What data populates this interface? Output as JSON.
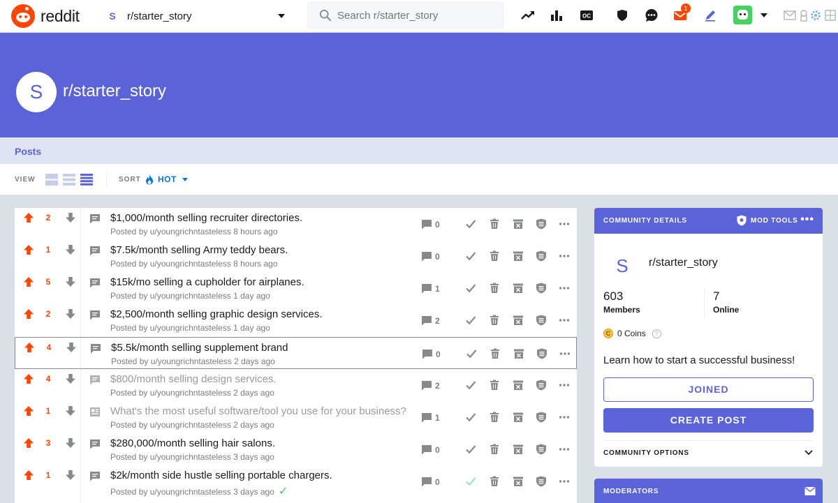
{
  "header": {
    "brand": "reddit",
    "community_icon_letter": "S",
    "community_name": "r/starter_story",
    "search_placeholder": "Search r/starter_story",
    "notification_count": "1",
    "icons": [
      "popular-icon",
      "all-icon",
      "oc-icon",
      "shield-icon",
      "chat-icon",
      "inbox-icon",
      "create-post-icon",
      "avatar",
      "chevron-down-icon",
      "mail-icon",
      "ext-icon",
      "settings-icon"
    ],
    "brand_color": "#ff4500"
  },
  "banner": {
    "icon_letter": "S",
    "title": "r/starter_story",
    "color": "#5b63d9"
  },
  "tabs": {
    "posts": "Posts"
  },
  "sortbar": {
    "view_label": "VIEW",
    "sort_label": "SORT",
    "sort_value": "HOT"
  },
  "posts": [
    {
      "score": "2",
      "title": "$1,000/month selling recruiter directories.",
      "author": "Posted by u/youngrichntasteless",
      "time": "8 hours ago",
      "comments": "0",
      "read": false,
      "approved": false,
      "type": "text"
    },
    {
      "score": "1",
      "title": "$7.5k/month selling Army teddy bears.",
      "author": "Posted by u/youngrichntasteless",
      "time": "8 hours ago",
      "comments": "0",
      "read": false,
      "approved": false,
      "type": "text"
    },
    {
      "score": "5",
      "title": "$15k/mo selling a cupholder for airplanes.",
      "author": "Posted by u/youngrichntasteless",
      "time": "1 day ago",
      "comments": "1",
      "read": false,
      "approved": false,
      "type": "text"
    },
    {
      "score": "2",
      "title": "$2,500/month selling graphic design services.",
      "author": "Posted by u/youngrichntasteless",
      "time": "1 day ago",
      "comments": "2",
      "read": false,
      "approved": false,
      "type": "text"
    },
    {
      "score": "4",
      "title": "$5.5k/month selling supplement brand",
      "author": "Posted by u/youngrichntasteless",
      "time": "2 days ago",
      "comments": "0",
      "read": false,
      "approved": false,
      "type": "text",
      "selected": true
    },
    {
      "score": "4",
      "title": "$800/month selling design services.",
      "author": "Posted by u/youngrichntasteless",
      "time": "2 days ago",
      "comments": "2",
      "read": true,
      "approved": false,
      "type": "text"
    },
    {
      "score": "1",
      "title": "What's the most useful software/tool you use for your business?",
      "author": "Posted by u/youngrichntasteless",
      "time": "2 days ago",
      "comments": "1",
      "read": true,
      "approved": false,
      "type": "link"
    },
    {
      "score": "3",
      "title": "$280,000/month selling hair salons.",
      "author": "Posted by u/youngrichntasteless",
      "time": "3 days ago",
      "comments": "0",
      "read": false,
      "approved": false,
      "type": "text"
    },
    {
      "score": "1",
      "title": "$2k/month side hustle selling portable chargers.",
      "author": "Posted by u/youngrichntasteless",
      "time": "3 days ago",
      "comments": "0",
      "read": false,
      "approved": true,
      "type": "text"
    }
  ],
  "sidebar": {
    "details_title": "COMMUNITY DETAILS",
    "mod_tools": "MOD TOOLS",
    "icon_letter": "S",
    "name": "r/starter_story",
    "members_count": "603",
    "members_label": "Members",
    "online_count": "7",
    "online_label": "Online",
    "coins": "0 Coins",
    "coin_glyph": "C",
    "help_glyph": "?",
    "description": "Learn how to start a successful business!",
    "joined_label": "JOINED",
    "create_post_label": "CREATE POST",
    "options_label": "COMMUNITY OPTIONS",
    "moderators_title": "MODERATORS"
  }
}
